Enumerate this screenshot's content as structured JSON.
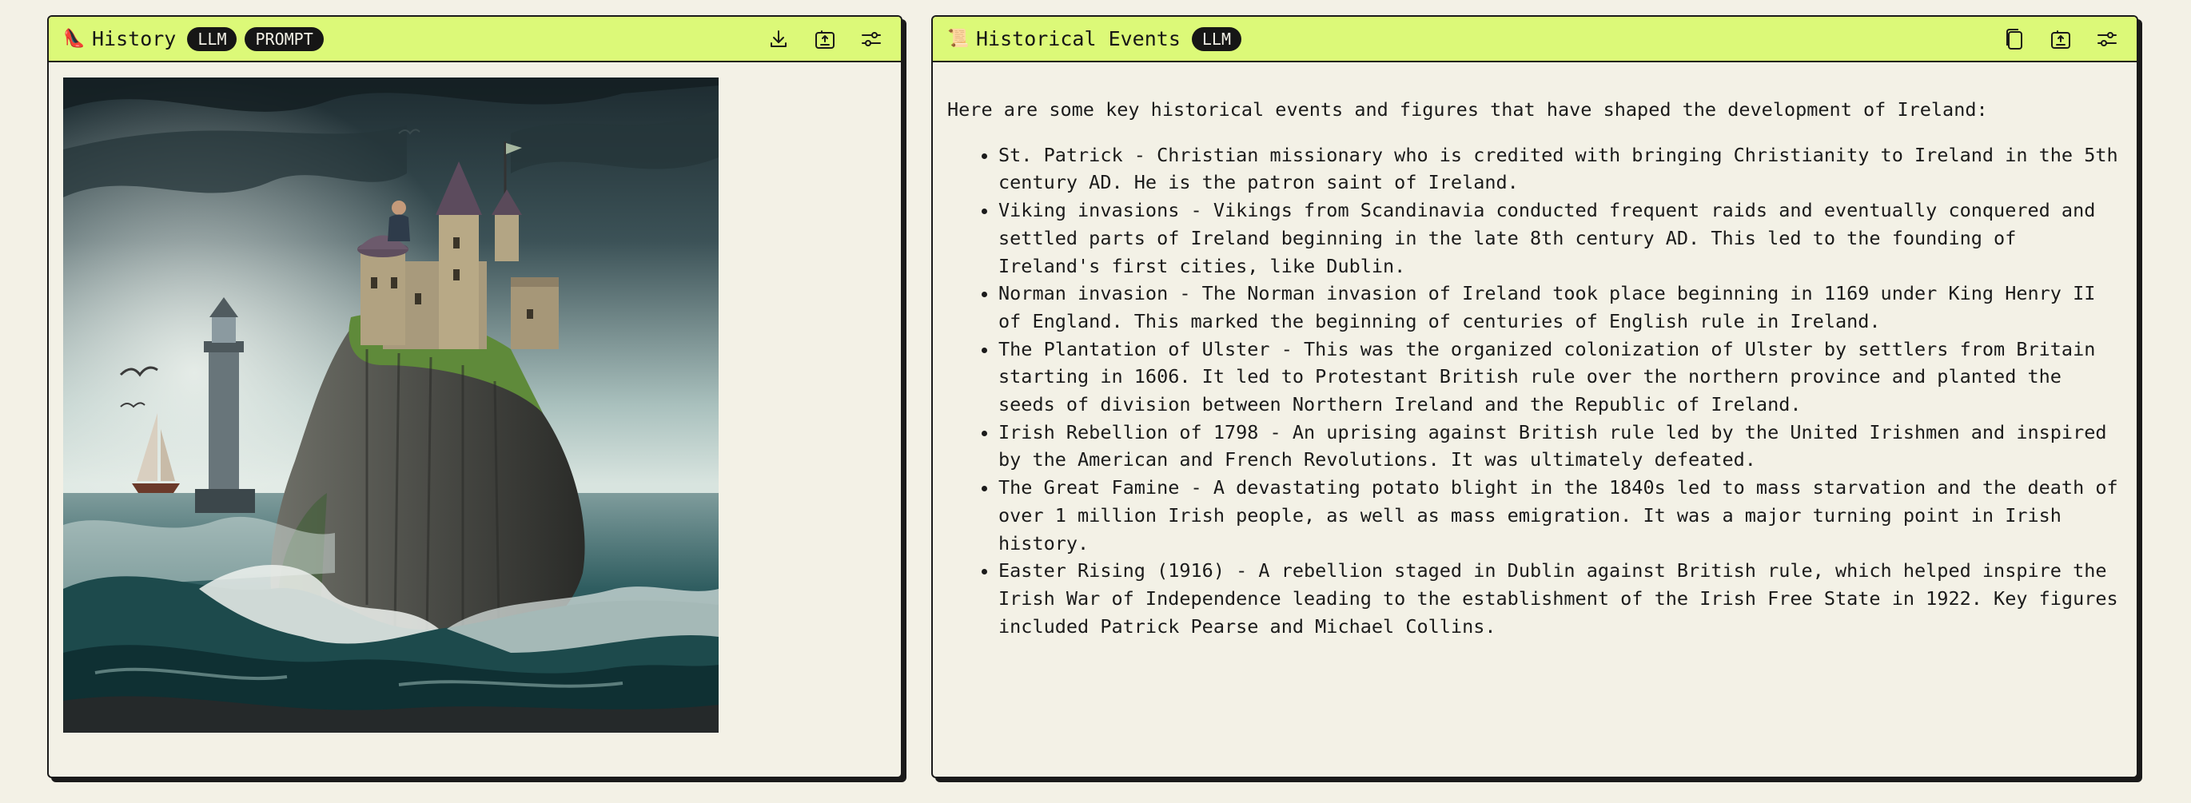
{
  "left_panel": {
    "emoji": "👠",
    "title": "History",
    "badges": [
      "LLM",
      "PROMPT"
    ],
    "image_alt": "Castle on a sea cliff with lighthouse, sailboat and seagulls under stormy sky",
    "toolbar": [
      "download-icon",
      "share-icon",
      "settings-icon"
    ]
  },
  "right_panel": {
    "emoji": "📜",
    "title": "Historical Events",
    "badges": [
      "LLM"
    ],
    "toolbar": [
      "copy-icon",
      "share-icon",
      "settings-icon"
    ],
    "intro": "Here are some key historical events and figures that have shaped the development of Ireland:",
    "events": [
      "St. Patrick - Christian missionary who is credited with bringing Christianity to Ireland in the 5th century AD. He is the patron saint of Ireland.",
      "Viking invasions - Vikings from Scandinavia conducted frequent raids and eventually conquered and settled parts of Ireland beginning in the late 8th century AD. This led to the founding of Ireland's first cities, like Dublin.",
      "Norman invasion - The Norman invasion of Ireland took place beginning in 1169 under King Henry II of England. This marked the beginning of centuries of English rule in Ireland.",
      "The Plantation of Ulster - This was the organized colonization of Ulster by settlers from Britain starting in 1606. It led to Protestant British rule over the northern province and planted the seeds of division between Northern Ireland and the Republic of Ireland.",
      "Irish Rebellion of 1798 - An uprising against British rule led by the United Irishmen and inspired by the American and French Revolutions. It was ultimately defeated.",
      "The Great Famine - A devastating potato blight in the 1840s led to mass starvation and the death of over 1 million Irish people, as well as mass emigration. It was a major turning point in Irish history.",
      "Easter Rising (1916) - A rebellion staged in Dublin against British rule, which helped inspire the Irish War of Independence leading to the establishment of the Irish Free State in 1922. Key figures included Patrick Pearse and Michael Collins."
    ]
  }
}
